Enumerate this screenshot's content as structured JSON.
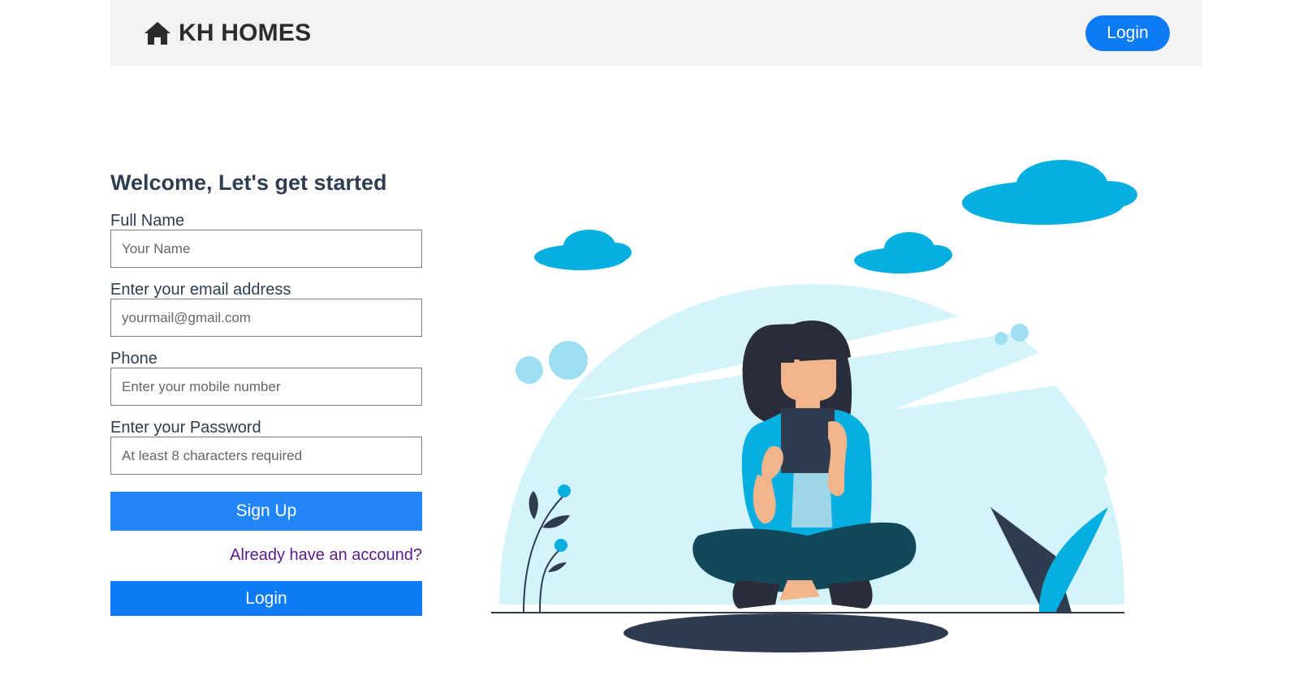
{
  "header": {
    "brand_icon": "home-icon",
    "brand_name": "KH HOMES",
    "login_label": "Login"
  },
  "form": {
    "title": "Welcome, Let's get started",
    "fields": [
      {
        "label": "Full Name",
        "placeholder": "Your Name",
        "value": ""
      },
      {
        "label": "Enter your email address",
        "placeholder": "yourmail@gmail.com",
        "value": ""
      },
      {
        "label": "Phone",
        "placeholder": "Enter your mobile number",
        "value": ""
      },
      {
        "label": "Enter your Password",
        "placeholder": "At least 8 characters required",
        "value": ""
      }
    ],
    "signup_label": "Sign Up",
    "account_link": "Already have an accound?",
    "login_label": "Login"
  },
  "illustration": {
    "icon": "woman-reading-tablet-illustration"
  },
  "colors": {
    "primary": "#0d7bf5",
    "signup": "#2286f7",
    "nav_bg": "#f3f3f3",
    "link": "#5a1a8c",
    "sky": "#d4f4fc",
    "cloud": "#07aee0",
    "dark": "#2f3b4f"
  }
}
